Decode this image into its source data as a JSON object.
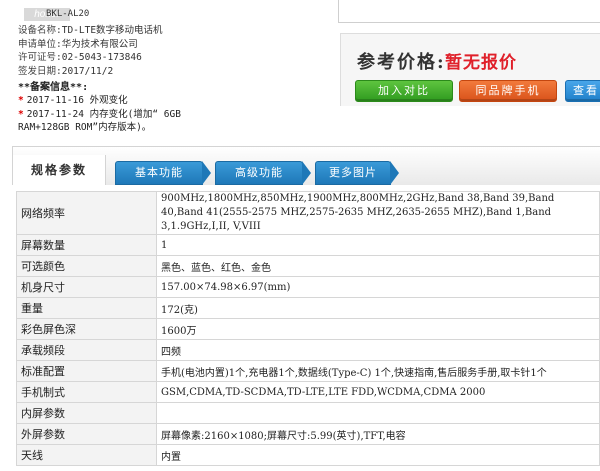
{
  "header": {
    "brand_logo_text": "honor",
    "model_code": "BKL-AL20",
    "info_lines": [
      {
        "label": "设备名称:",
        "value": "TD-LTE数字移动电话机"
      },
      {
        "label": "申请单位:",
        "value": "华为技术有限公司"
      },
      {
        "label": "许可证号:",
        "value": "02-5043-173846"
      },
      {
        "label": "签发日期:",
        "value": "2017/11/2"
      }
    ],
    "filing_title": "**备案信息**:",
    "filing_items": [
      {
        "star": "*",
        "text": "2017-11-16  外观变化"
      },
      {
        "star": "*",
        "text": "2017-11-24  内存变化(增加“ 6GB"
      }
    ],
    "filing_item_continuation": "RAM+128GB ROM”内存版本)。"
  },
  "price": {
    "label": "参考价格:",
    "value": "暂无报价"
  },
  "buttons": {
    "compare": "加入对比",
    "same_brand": "同品牌手机",
    "view": "查看"
  },
  "tabs": [
    "规格参数",
    "基本功能",
    "高级功能",
    "更多图片"
  ],
  "specs": [
    {
      "key": "网络频率",
      "value": "900MHz,1800MHz,850MHz,1900MHz,800MHz,2GHz,Band 38,Band 39,Band 40,Band 41(2555-2575 MHZ,2575-2635 MHZ,2635-2655 MHZ),Band 1,Band 3,1.9GHz,I,II, V,VIII"
    },
    {
      "key": "屏幕数量",
      "value": "1"
    },
    {
      "key": "可选颜色",
      "value": "黑色、蓝色、红色、金色"
    },
    {
      "key": "机身尺寸",
      "value": "157.00×74.98×6.97(mm)"
    },
    {
      "key": "重量",
      "value": "172(克)"
    },
    {
      "key": "彩色屏色深",
      "value": "1600万"
    },
    {
      "key": "承载频段",
      "value": "四频"
    },
    {
      "key": "标准配置",
      "value": "手机(电池内置)1个,充电器1个,数据线(Type-C) 1个,快速指南,售后服务手册,取卡针1个"
    },
    {
      "key": "手机制式",
      "value": "GSM,CDMA,TD-SCDMA,TD-LTE,LTE FDD,WCDMA,CDMA 2000"
    },
    {
      "key": "内屏参数",
      "value": ""
    },
    {
      "key": "外屏参数",
      "value": "屏幕像素:2160×1080;屏幕尺寸:5.99(英寸),TFT,电容"
    },
    {
      "key": "天线",
      "value": "内置"
    }
  ],
  "colors": {
    "price_red": "#e0202a",
    "tab_blue": "#1e78b8",
    "compare_green": "#2f9b1f",
    "samebrand_orange": "#d9521a",
    "view_blue": "#1f7fc9"
  }
}
